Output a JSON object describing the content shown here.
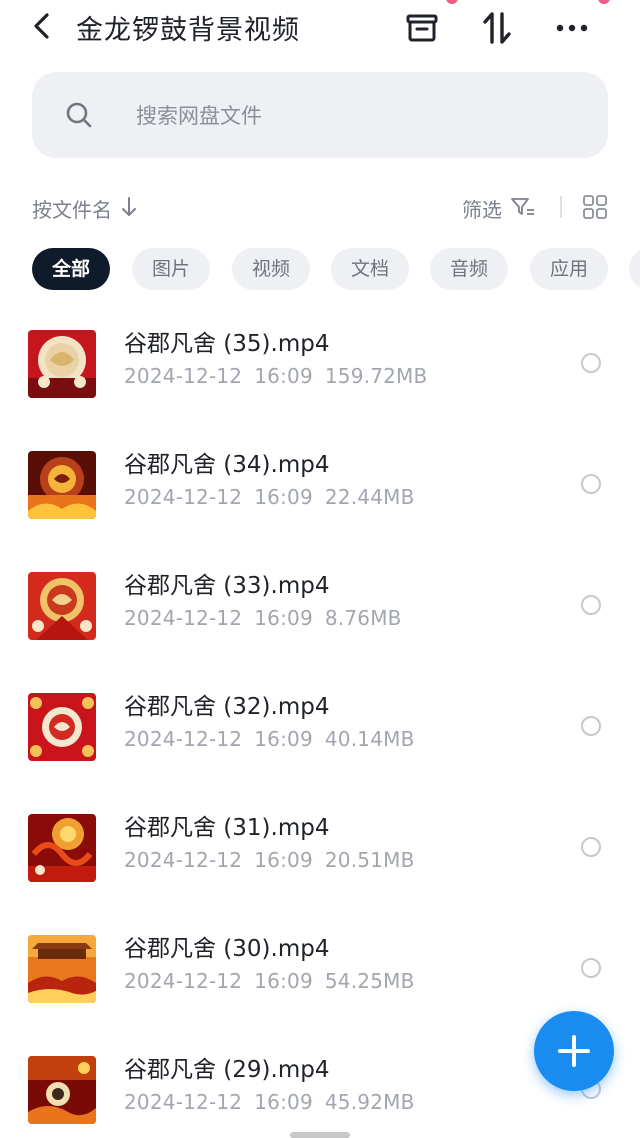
{
  "header": {
    "title": "金龙锣鼓背景视频",
    "icons": [
      "back-chevron-icon",
      "archive-box-icon",
      "sort-arrows-icon",
      "more-dots-icon"
    ]
  },
  "search": {
    "placeholder": "搜索网盘文件",
    "icon": "search-icon"
  },
  "sortbar": {
    "sort_label": "按文件名",
    "filter_label": "筛选",
    "icons": [
      "sort-down-arrow-icon",
      "filter-funnel-icon",
      "grid-view-icon"
    ]
  },
  "chips": [
    {
      "label": "全部",
      "active": true
    },
    {
      "label": "图片",
      "active": false
    },
    {
      "label": "视频",
      "active": false
    },
    {
      "label": "文档",
      "active": false
    },
    {
      "label": "音频",
      "active": false
    },
    {
      "label": "应用",
      "active": false
    }
  ],
  "files": [
    {
      "name": "谷郡凡舍 (35).mp4",
      "date": "2024-12-12",
      "time": "16:09",
      "size": "159.72MB"
    },
    {
      "name": "谷郡凡舍 (34).mp4",
      "date": "2024-12-12",
      "time": "16:09",
      "size": "22.44MB"
    },
    {
      "name": "谷郡凡舍 (33).mp4",
      "date": "2024-12-12",
      "time": "16:09",
      "size": "8.76MB"
    },
    {
      "name": "谷郡凡舍 (32).mp4",
      "date": "2024-12-12",
      "time": "16:09",
      "size": "40.14MB"
    },
    {
      "name": "谷郡凡舍 (31).mp4",
      "date": "2024-12-12",
      "time": "16:09",
      "size": "20.51MB"
    },
    {
      "name": "谷郡凡舍 (30).mp4",
      "date": "2024-12-12",
      "time": "16:09",
      "size": "54.25MB"
    },
    {
      "name": "谷郡凡舍 (29).mp4",
      "date": "2024-12-12",
      "time": "16:09",
      "size": "45.92MB"
    }
  ],
  "fab": {
    "icon": "plus-icon"
  },
  "colors": {
    "accent": "#1a8cf0",
    "chip_active_bg": "#0f1a2b",
    "chip_bg": "#eef0f4",
    "meta_text": "#a2a6ae",
    "thumb_red": "#c4161c",
    "thumb_gold": "#f2b53a"
  }
}
